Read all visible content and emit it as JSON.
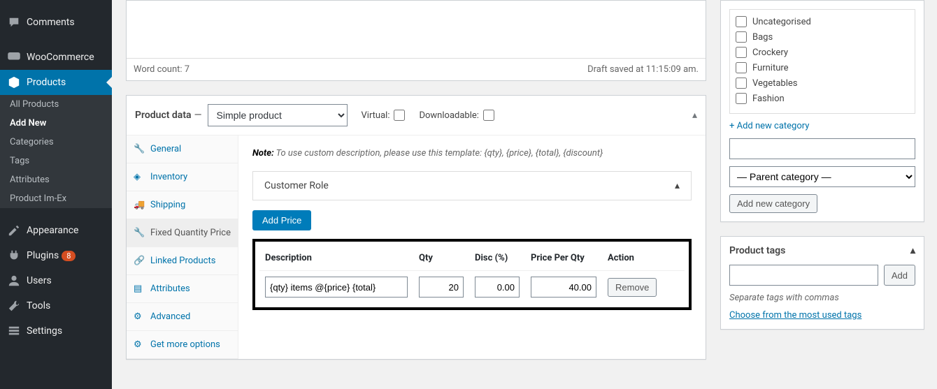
{
  "sidebar": {
    "items": [
      {
        "label": "Comments",
        "icon": "comments"
      },
      {
        "label": "WooCommerce",
        "icon": "woo"
      },
      {
        "label": "Products",
        "icon": "products",
        "active": true,
        "subs": [
          {
            "label": "All Products"
          },
          {
            "label": "Add New",
            "current": true
          },
          {
            "label": "Categories"
          },
          {
            "label": "Tags"
          },
          {
            "label": "Attributes"
          },
          {
            "label": "Product Im-Ex"
          }
        ]
      },
      {
        "label": "Appearance",
        "icon": "appearance"
      },
      {
        "label": "Plugins",
        "icon": "plugins",
        "badge": "8"
      },
      {
        "label": "Users",
        "icon": "users"
      },
      {
        "label": "Tools",
        "icon": "tools"
      },
      {
        "label": "Settings",
        "icon": "settings"
      }
    ]
  },
  "editor": {
    "word_count_label": "Word count: 7",
    "draft_label": "Draft saved at 11:15:09 am."
  },
  "product_data": {
    "title": "Product data",
    "dash": "—",
    "type_selected": "Simple product",
    "virtual_label": "Virtual:",
    "downloadable_label": "Downloadable:",
    "tabs": [
      {
        "label": "General",
        "icon": "wrench"
      },
      {
        "label": "Inventory",
        "icon": "inventory"
      },
      {
        "label": "Shipping",
        "icon": "shipping"
      },
      {
        "label": "Fixed Quantity Price",
        "icon": "wrench",
        "active": true
      },
      {
        "label": "Linked Products",
        "icon": "link"
      },
      {
        "label": "Attributes",
        "icon": "list"
      },
      {
        "label": "Advanced",
        "icon": "gear"
      },
      {
        "label": "Get more options",
        "icon": "gear"
      }
    ],
    "note_strong": "Note:",
    "note_text": " To use custom description, please use this template: {qty}, {price}, {total}, {discount}",
    "role_label": "Customer Role",
    "add_price_btn": "Add Price",
    "table": {
      "headers": {
        "desc": "Description",
        "qty": "Qty",
        "disc": "Disc (%)",
        "ppq": "Price Per Qty",
        "action": "Action"
      },
      "row": {
        "desc": "{qty} items @{price} {total}",
        "qty": "20",
        "disc": "0.00",
        "ppq": "40.00",
        "remove": "Remove"
      }
    }
  },
  "categories": {
    "items": [
      "Uncategorised",
      "Bags",
      "Crockery",
      "Furniture",
      "Vegetables",
      "Fashion"
    ],
    "add_link": "+ Add new category",
    "parent_placeholder": "— Parent category —",
    "add_btn": "Add new category"
  },
  "tags": {
    "title": "Product tags",
    "add_btn": "Add",
    "hint": "Separate tags with commas",
    "choose_link": "Choose from the most used tags"
  }
}
